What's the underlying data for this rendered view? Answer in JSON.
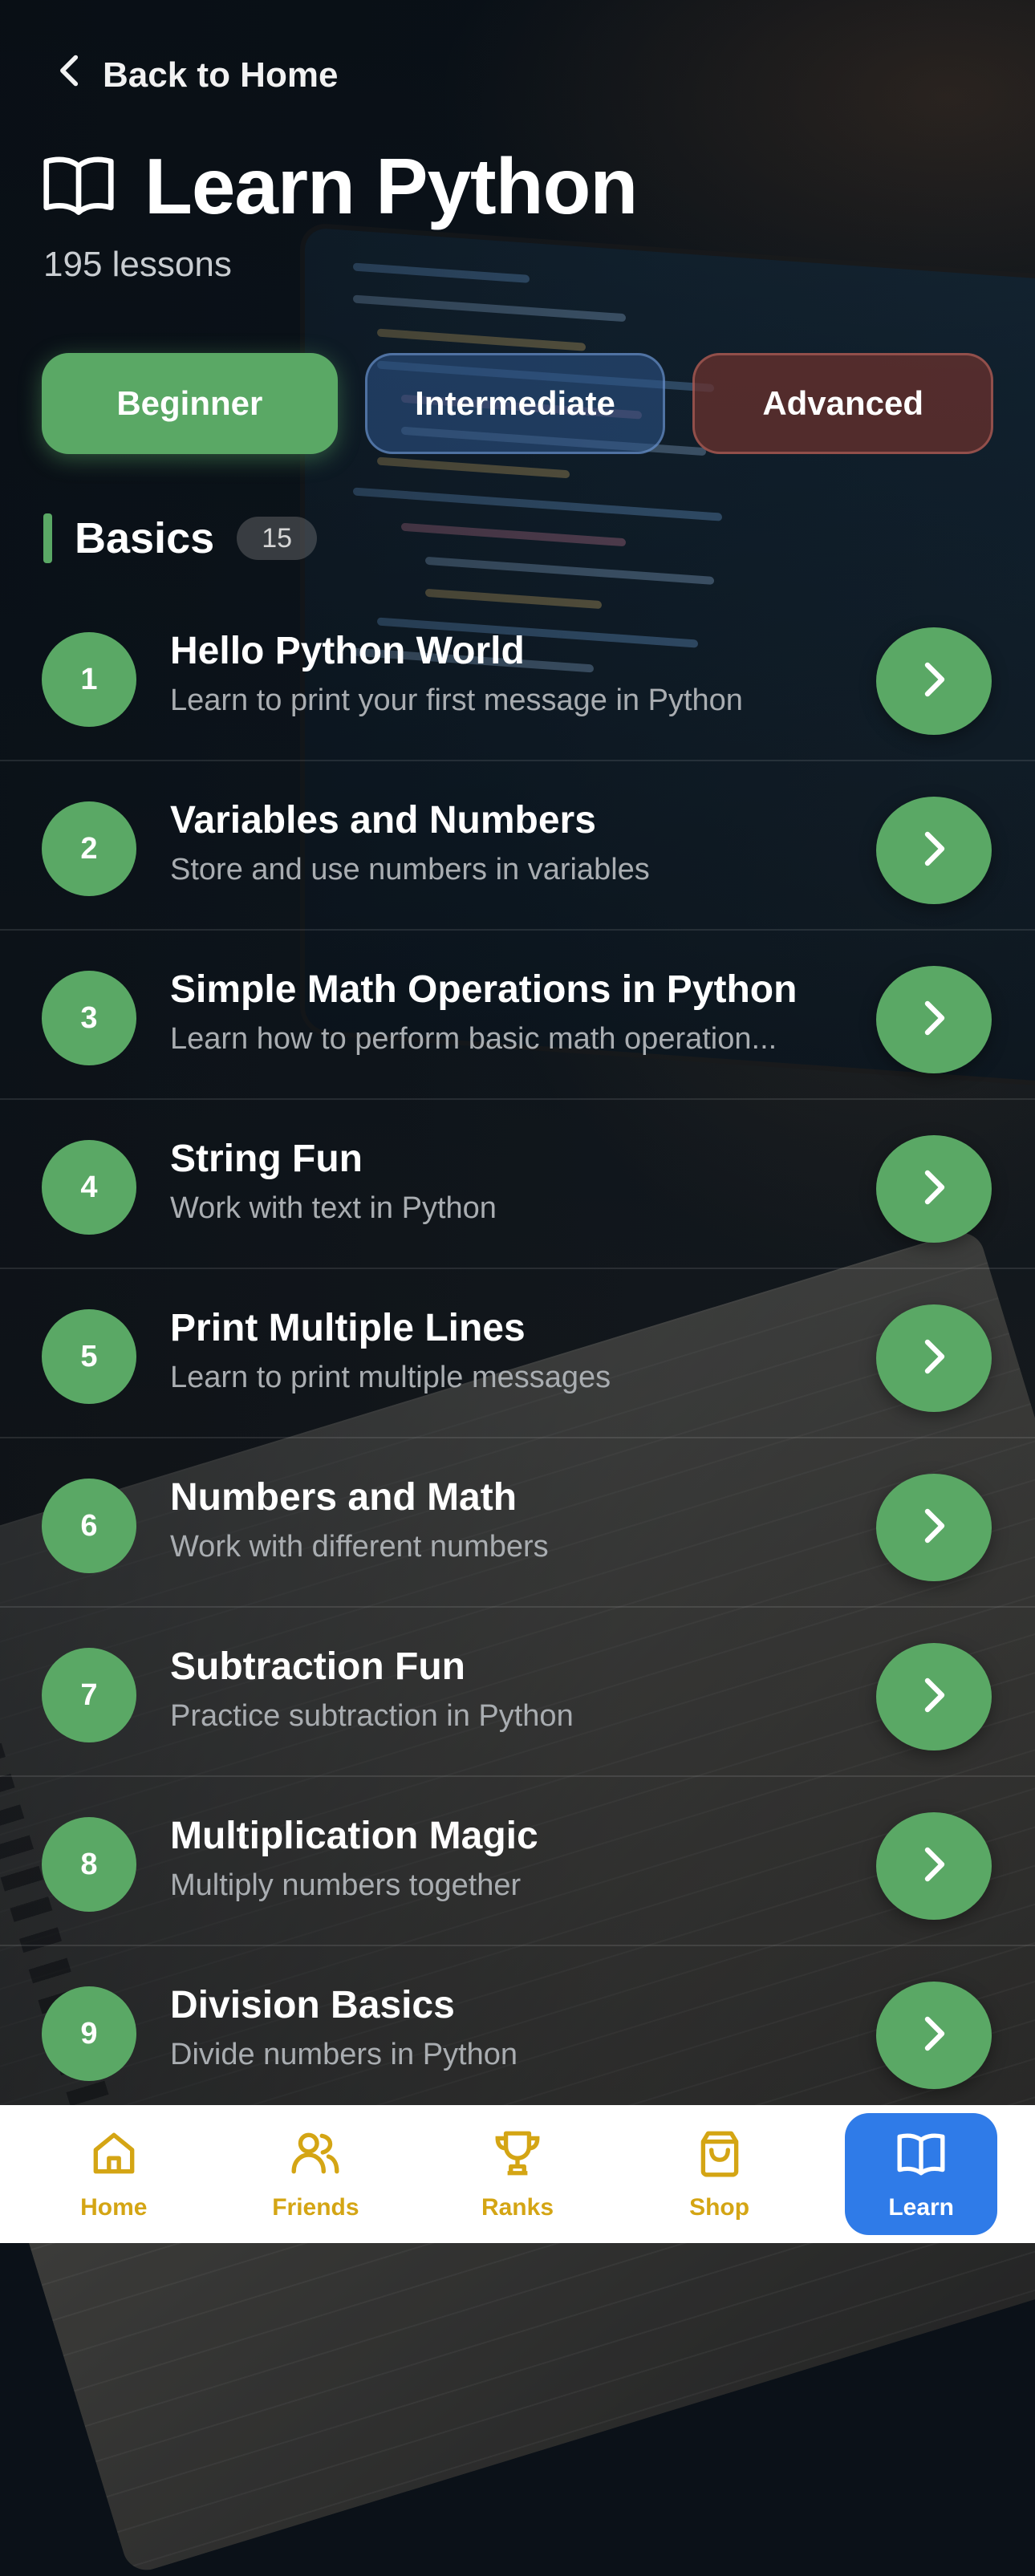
{
  "header": {
    "back_label": "Back to Home",
    "title": "Learn Python",
    "lessons_count": "195 lessons"
  },
  "tabs": [
    {
      "label": "Beginner",
      "selected": true
    },
    {
      "label": "Intermediate",
      "selected": false
    },
    {
      "label": "Advanced",
      "selected": false
    }
  ],
  "section": {
    "title": "Basics",
    "count": "15"
  },
  "lessons": [
    {
      "number": "1",
      "title": "Hello Python World",
      "description": "Learn to print your first message in Python"
    },
    {
      "number": "2",
      "title": "Variables and Numbers",
      "description": "Store and use numbers in variables"
    },
    {
      "number": "3",
      "title": "Simple Math Operations in Python",
      "description": "Learn how to perform basic math operation..."
    },
    {
      "number": "4",
      "title": "String Fun",
      "description": "Work with text in Python"
    },
    {
      "number": "5",
      "title": "Print Multiple Lines",
      "description": "Learn to print multiple messages"
    },
    {
      "number": "6",
      "title": "Numbers and Math",
      "description": "Work with different numbers"
    },
    {
      "number": "7",
      "title": "Subtraction Fun",
      "description": "Practice subtraction in Python"
    },
    {
      "number": "8",
      "title": "Multiplication Magic",
      "description": "Multiply numbers together"
    },
    {
      "number": "9",
      "title": "Division Basics",
      "description": "Divide numbers in Python"
    }
  ],
  "nav": [
    {
      "label": "Home",
      "icon": "home-icon",
      "active": false
    },
    {
      "label": "Friends",
      "icon": "friends-icon",
      "active": false
    },
    {
      "label": "Ranks",
      "icon": "trophy-icon",
      "active": false
    },
    {
      "label": "Shop",
      "icon": "shopping-bag-icon",
      "active": false
    },
    {
      "label": "Learn",
      "icon": "book-icon",
      "active": true
    }
  ],
  "colors": {
    "accent_green": "#5aa865",
    "nav_gold": "#d4a514",
    "nav_active_blue": "#2f7be8",
    "intermediate_blue": "#2e568c",
    "advanced_red": "#69322d"
  }
}
